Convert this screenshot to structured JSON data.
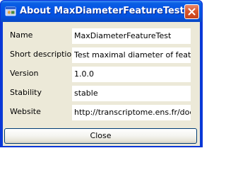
{
  "window": {
    "title": "About MaxDiameterFeatureTest"
  },
  "fields": [
    {
      "label": "Name",
      "value": "MaxDiameterFeatureTest"
    },
    {
      "label": "Short description",
      "value": "Test maximal diameter of features"
    },
    {
      "label": "Version",
      "value": "1.0.0"
    },
    {
      "label": "Stability",
      "value": "stable"
    },
    {
      "label": "Website",
      "value": "http://transcriptome.ens.fr/doelan"
    }
  ],
  "close_button": {
    "label": "Close"
  },
  "colors": {
    "titlebar": "#0554e6",
    "close_icon_bg": "#d8552c",
    "dialog_bg": "#ece9d8",
    "field_bg": "#ffffff"
  },
  "icons": {
    "app": "app-icon",
    "close": "close-icon"
  }
}
